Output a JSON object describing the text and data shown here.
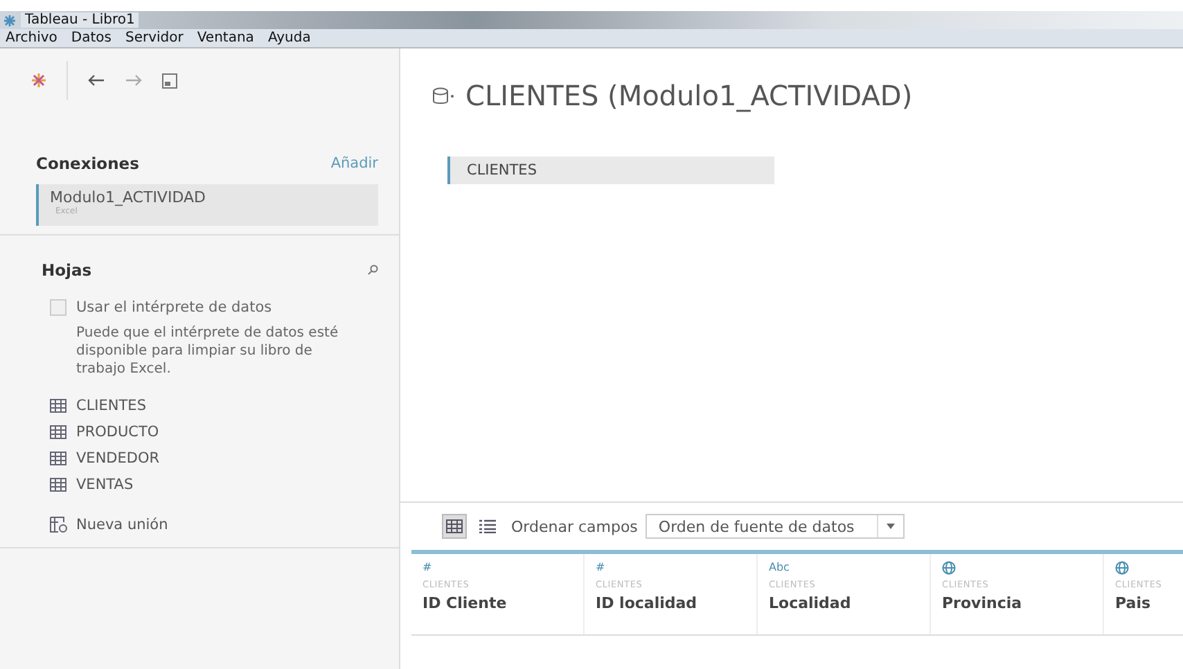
{
  "window": {
    "title": "Tableau - Libro1"
  },
  "menu": [
    "Archivo",
    "Datos",
    "Servidor",
    "Ventana",
    "Ayuda"
  ],
  "connections": {
    "heading": "Conexiones",
    "add_link": "Añadir",
    "items": [
      {
        "name": "Modulo1_ACTIVIDAD",
        "type": "Excel"
      }
    ]
  },
  "sheets": {
    "heading": "Hojas",
    "interpreter": {
      "label": "Usar el intérprete de datos",
      "checked": false,
      "hint": "Puede que el intérprete de datos esté disponible para limpiar su libro de trabajo Excel."
    },
    "items": [
      {
        "name": "CLIENTES"
      },
      {
        "name": "PRODUCTO"
      },
      {
        "name": "VENDEDOR"
      },
      {
        "name": "VENTAS"
      }
    ],
    "new_union": "Nueva unión"
  },
  "datasource": {
    "title": "CLIENTES (Modulo1_ACTIVIDAD)",
    "tables": [
      {
        "name": "CLIENTES"
      }
    ]
  },
  "grid": {
    "views": [
      {
        "kind": "grid",
        "selected": true
      },
      {
        "kind": "list",
        "selected": false
      }
    ],
    "sort_label": "Ordenar campos",
    "sort_value": "Orden de fuente de datos",
    "fields": [
      {
        "kind": "number",
        "symbol": "#",
        "table": "CLIENTES",
        "name": "ID Cliente"
      },
      {
        "kind": "number",
        "symbol": "#",
        "table": "CLIENTES",
        "name": "ID localidad"
      },
      {
        "kind": "text",
        "symbol": "Abc",
        "table": "CLIENTES",
        "name": "Localidad"
      },
      {
        "kind": "geo",
        "table": "CLIENTES",
        "name": "Provincia"
      },
      {
        "kind": "geo",
        "table": "CLIENTES",
        "name": "Pais"
      }
    ]
  }
}
